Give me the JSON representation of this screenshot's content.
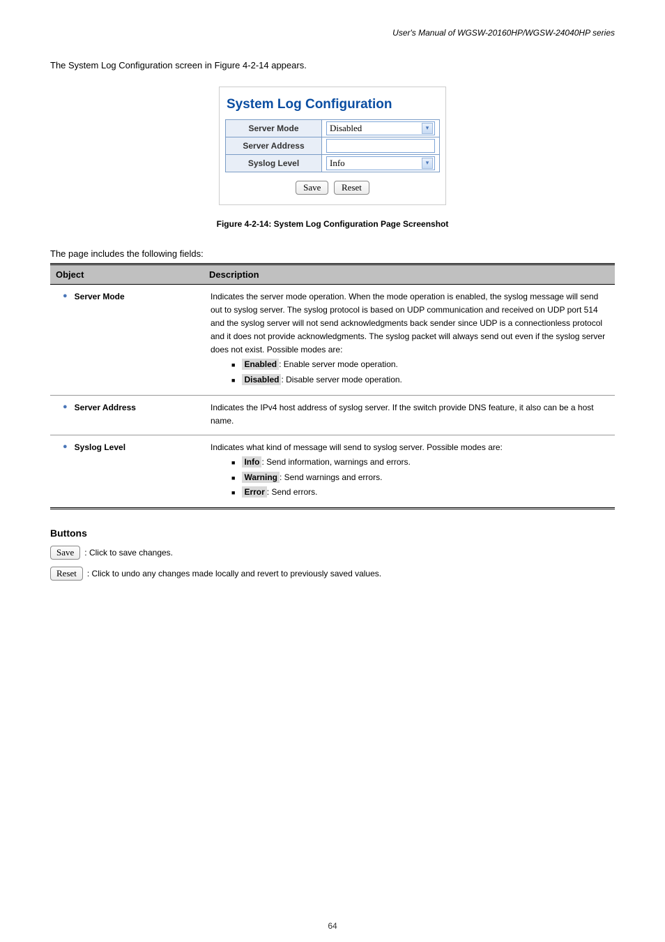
{
  "header": {
    "manual_title": "User's Manual of WGSW-20160HP/WGSW-24040HP series"
  },
  "intro": "The System Log Configuration screen in Figure 4-2-14 appears.",
  "config": {
    "title": "System Log Configuration",
    "rows": {
      "server_mode": {
        "label": "Server Mode",
        "value": "Disabled",
        "type": "select"
      },
      "server_address": {
        "label": "Server Address",
        "value": "",
        "type": "text"
      },
      "syslog_level": {
        "label": "Syslog Level",
        "value": "Info",
        "type": "select"
      }
    },
    "buttons": {
      "save": "Save",
      "reset": "Reset"
    }
  },
  "figure_caption": "Figure 4-2-14: System Log Configuration Page Screenshot",
  "desc_intro": "The page includes the following fields:",
  "table": {
    "head": {
      "object": "Object",
      "description": "Description"
    },
    "rows": [
      {
        "object": "Server Mode",
        "desc_lines": [
          "Indicates the server mode operation. When the mode operation is enabled, the syslog message will send out to syslog server. The syslog protocol is based on UDP communication and received on UDP port 514 and the syslog server will not send acknowledgments back sender since UDP is a connectionless protocol and it does not provide acknowledgments. The syslog packet will always send out even if the syslog server does not exist. Possible modes are:"
        ],
        "options": [
          {
            "label": "Enabled",
            "text": ": Enable server mode operation."
          },
          {
            "label": "Disabled",
            "text": ": Disable server mode operation."
          }
        ]
      },
      {
        "object": "Server Address",
        "desc_lines": [
          "Indicates the IPv4 host address of syslog server. If the switch provide DNS feature, it also can be a host name."
        ],
        "options": []
      },
      {
        "object": "Syslog Level",
        "desc_lines": [
          "Indicates what kind of message will send to syslog server. Possible modes are:"
        ],
        "options": [
          {
            "label": "Info",
            "text": ": Send information, warnings and errors."
          },
          {
            "label": "Warning",
            "text": ": Send warnings and errors."
          },
          {
            "label": "Error",
            "text": ": Send errors."
          }
        ]
      }
    ]
  },
  "buttons_section": {
    "heading": "Buttons",
    "items": [
      {
        "label": "Save",
        "desc": ": Click to save changes."
      },
      {
        "label": "Reset",
        "desc": ": Click to undo any changes made locally and revert to previously saved values."
      }
    ]
  },
  "footer": {
    "page": "64"
  }
}
